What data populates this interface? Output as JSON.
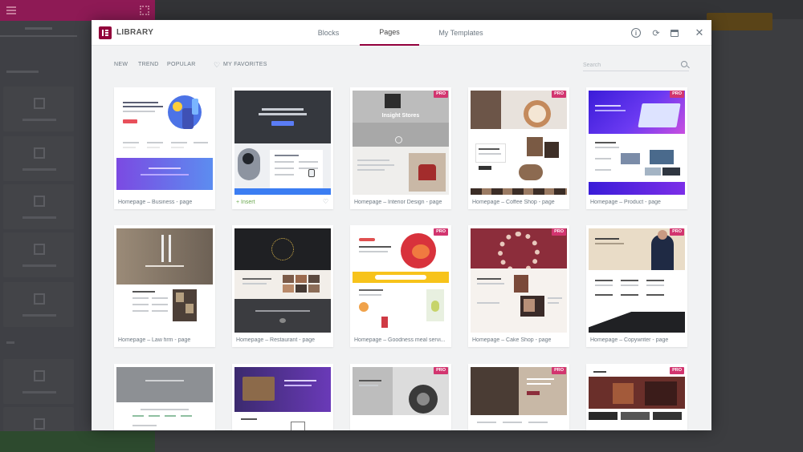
{
  "modal": {
    "title": "LIBRARY",
    "tabs": [
      {
        "label": "Blocks"
      },
      {
        "label": "Pages",
        "active": true
      },
      {
        "label": "My Templates"
      }
    ],
    "header_icons": [
      "info-icon",
      "sync-icon",
      "save-icon",
      "close-icon"
    ],
    "close_glyph": "✕",
    "info_glyph": "i",
    "sync_glyph": "⟳"
  },
  "toolbar": {
    "filters": [
      "NEW",
      "TREND",
      "POPULAR"
    ],
    "favorites": "MY FAVORITES",
    "search_placeholder": "Search"
  },
  "templates": [
    {
      "name": "Homepage – Business - page",
      "pro": false
    },
    {
      "name": "Insert",
      "pro": false,
      "hovered": true
    },
    {
      "name": "Homepage – Interior Design - page",
      "pro": true
    },
    {
      "name": "Homepage – Coffee Shop - page",
      "pro": true
    },
    {
      "name": "Homepage – Product - page",
      "pro": true
    },
    {
      "name": "Homepage – Law firm - page",
      "pro": false
    },
    {
      "name": "Homepage – Restaurant - page",
      "pro": false
    },
    {
      "name": "Homepage – Goodness meal servi...",
      "pro": true
    },
    {
      "name": "Homepage – Cake Shop - page",
      "pro": true
    },
    {
      "name": "Homepage – Copywriter - page",
      "pro": true
    },
    {
      "name": "",
      "pro": false
    },
    {
      "name": "",
      "pro": false
    },
    {
      "name": "",
      "pro": true
    },
    {
      "name": "",
      "pro": true
    },
    {
      "name": "",
      "pro": true
    }
  ],
  "thumb_texts": {
    "interior": "Insight Stores"
  },
  "badges": {
    "pro": "PRO",
    "insert_glyph": "+",
    "heart_glyph": "♡"
  },
  "colors": {
    "brand": "#92003b",
    "pro": "#d2356f",
    "active_tab": "#93003c"
  }
}
